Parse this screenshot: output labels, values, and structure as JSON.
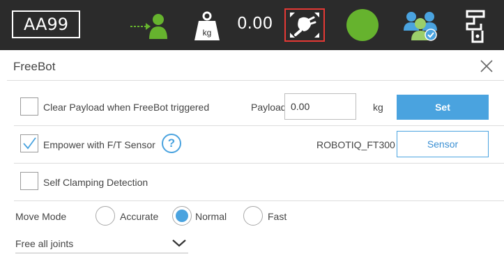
{
  "topbar": {
    "robot_id": "AA99",
    "payload_value": "0.00",
    "icons": [
      "move-to-user-icon",
      "payload-weight-icon",
      "freebot-icon",
      "status-indicator",
      "users-icon",
      "tool-icon"
    ],
    "weight_label": "kg",
    "status_color": "#66b32e",
    "highlight_color": "#e53935"
  },
  "dialog": {
    "title": "FreeBot",
    "clear_payload": {
      "label": "Clear Payload when FreeBot triggered",
      "checked": false
    },
    "payload": {
      "label": "Payload",
      "value": "0.00",
      "unit": "kg",
      "set_label": "Set"
    },
    "ft_sensor": {
      "label": "Empower with F/T Sensor",
      "checked": true,
      "sensor_name": "ROBOTIQ_FT300",
      "sensor_button": "Sensor"
    },
    "self_clamping": {
      "label": "Self Clamping Detection",
      "checked": false
    },
    "move_mode": {
      "label": "Move Mode",
      "options": [
        "Accurate",
        "Normal",
        "Fast"
      ],
      "selected": "Normal"
    },
    "joints_select": {
      "value": "Free all joints"
    }
  },
  "colors": {
    "accent": "#4aa3df",
    "topbar_bg": "#2b2b2b"
  }
}
